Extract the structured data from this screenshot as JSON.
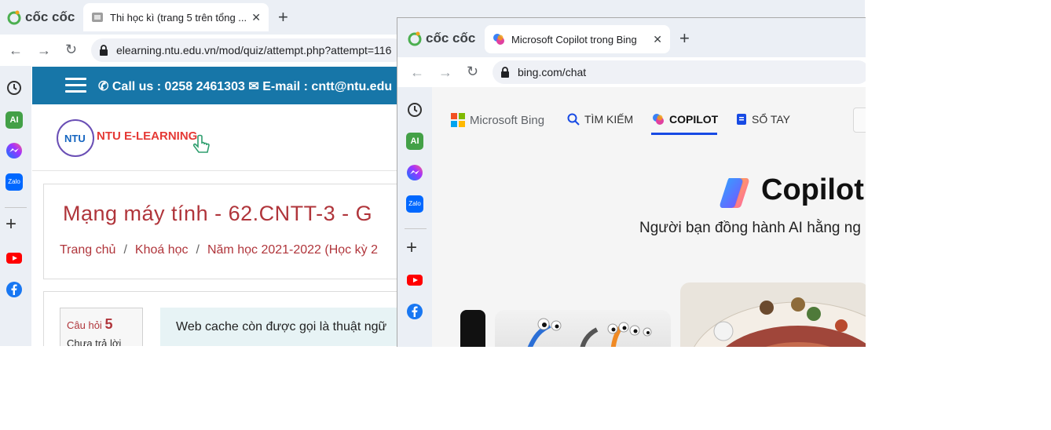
{
  "back_window": {
    "browser_name": "cốc cốc",
    "tab": {
      "title": "Thi học kì (trang 5 trên tổng ...",
      "close_icon": "close-icon"
    },
    "new_tab_icon": "plus-icon",
    "url": "elearning.ntu.edu.vn/mod/quiz/attempt.php?attempt=116",
    "sidebar": [
      "history-icon",
      "ai-icon",
      "messenger-icon",
      "zalo-icon",
      "plus-icon",
      "youtube-icon",
      "facebook-icon"
    ],
    "sidebar_ai_label": "AI",
    "sidebar_zalo_label": "Zalo",
    "header": {
      "contact_call": "Call us : 0258 2461303",
      "contact_email": "E-mail : cntt@ntu.edu"
    },
    "logo_text": "NTU E-LEARNING",
    "logo_badge": "NTU",
    "course_title": "Mạng máy tính - 62.CNTT-3 - G",
    "breadcrumb": [
      "Trang chủ",
      "Khoá học",
      "Năm học 2021-2022 (Học kỳ 2"
    ],
    "question": {
      "label": "Câu hỏi",
      "number": "5",
      "status": "Chưa trả lời",
      "text": "Web cache còn được gọi là thuật ngữ"
    }
  },
  "front_window": {
    "browser_name": "cốc cốc",
    "tab": {
      "title": "Microsoft Copilot trong Bing",
      "close_icon": "close-icon"
    },
    "url": "bing.com/chat",
    "sidebar_ai_label": "AI",
    "sidebar_zalo_label": "Zalo",
    "bing_nav": {
      "brand": "Microsoft Bing",
      "items": [
        {
          "label": "TÌM KIẾM",
          "icon": "search-icon"
        },
        {
          "label": "COPILOT",
          "icon": "copilot-icon",
          "active": true
        },
        {
          "label": "SỔ TAY",
          "icon": "notebook-icon"
        }
      ]
    },
    "hero": {
      "title": "Copilot",
      "subtitle": "Người bạn đồng hành AI hằng ng"
    }
  },
  "colors": {
    "ntu_header": "#1776a8",
    "course_red": "#b0353b",
    "bing_blue": "#174ae4",
    "browser_chrome": "#ebeff5"
  }
}
